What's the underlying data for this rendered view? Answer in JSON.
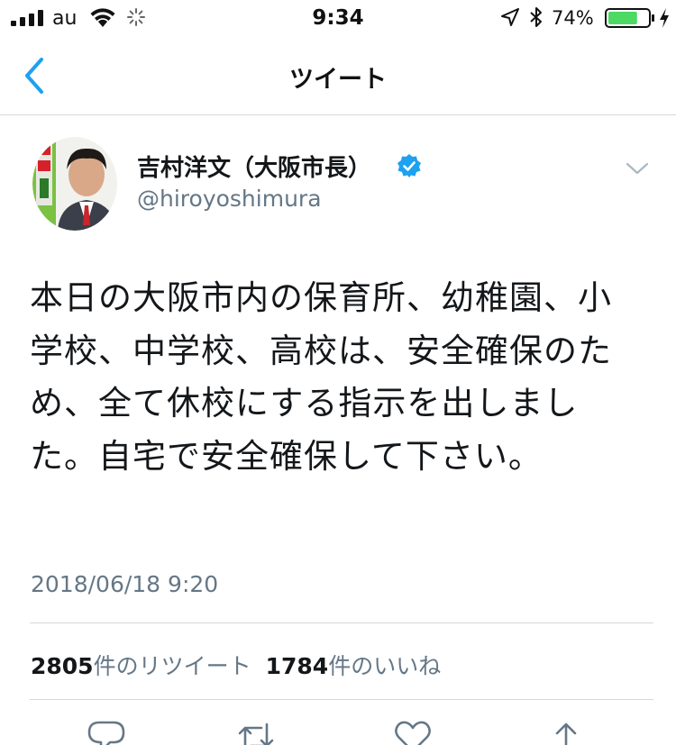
{
  "status_bar": {
    "carrier": "au",
    "time": "9:34",
    "battery_percent": "74%",
    "battery_level": 0.74,
    "battery_color": "#4cd964"
  },
  "nav": {
    "title": "ツイート",
    "back_icon": "chevron-left-icon"
  },
  "tweet": {
    "author_name": "吉村洋文（大阪市長）",
    "handle": "@hiroyoshimura",
    "verified": true,
    "text": "本日の大阪市内の保育所、幼稚園、小学校、中学校、高校は、安全確保のため、全て休校にする指示を出しました。自宅で安全確保して下さい。",
    "timestamp": "2018/06/18 9:20"
  },
  "stats": {
    "retweets_count": "2805",
    "retweets_label": "件のリツイート",
    "likes_count": "1784",
    "likes_label": "件のいいね"
  },
  "colors": {
    "accent": "#1da1f2",
    "secondary_text": "#657786",
    "primary_text": "#14171a"
  }
}
